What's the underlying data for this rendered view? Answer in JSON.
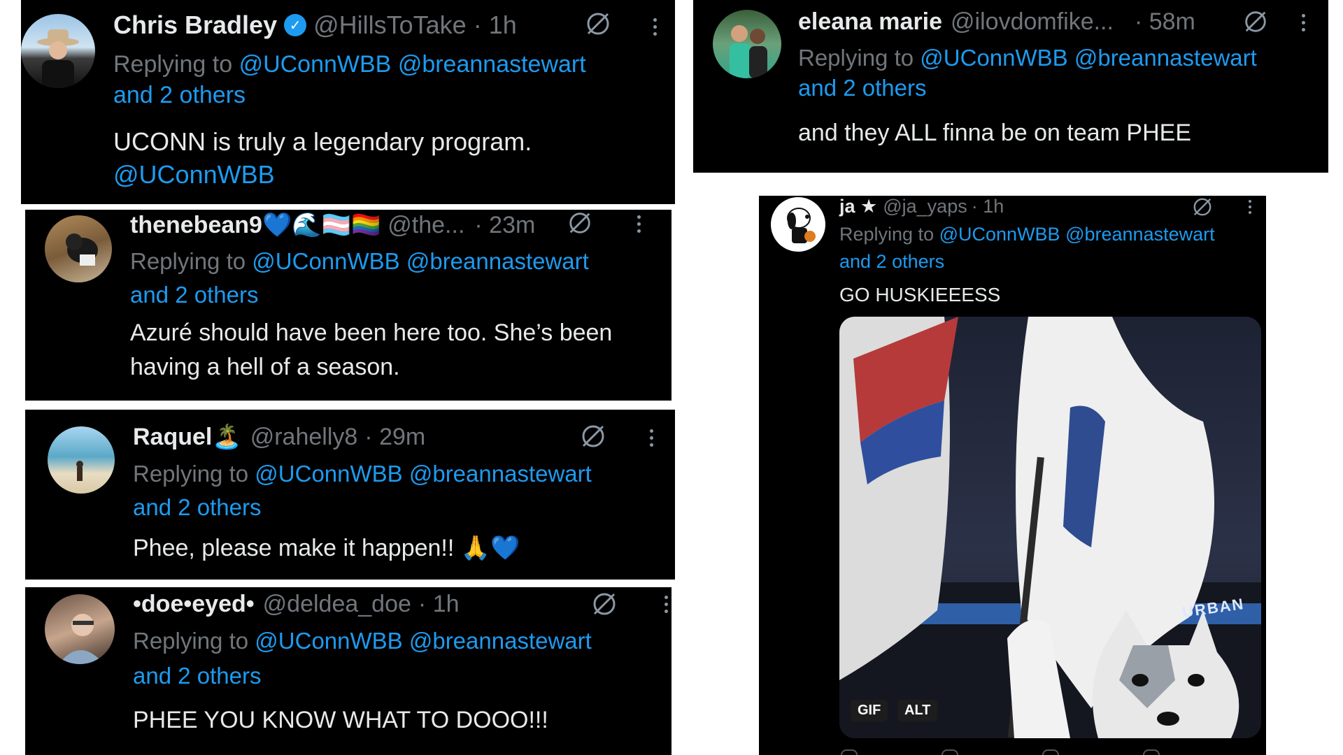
{
  "tweets": [
    {
      "name": "Chris Bradley",
      "handle": "@HillsToTake",
      "time": "· 1h",
      "replying_prefix": "Replying to",
      "mention1": "@UConnWBB",
      "mention2": "@breannastewart",
      "others": "and 2 others",
      "text_line1": "UCONN is truly a legendary program.",
      "text_line2": "@UConnWBB",
      "verified": true
    },
    {
      "name": "eleana marie",
      "handle": "@ilovdomfike...",
      "time": "· 58m",
      "replying_prefix": "Replying to",
      "mention1": "@UConnWBB",
      "mention2": "@breannastewart",
      "others": "and 2 others",
      "text_line1": "and they ALL finna be on team PHEE"
    },
    {
      "name": "thenebean9💙🌊🏳️‍⚧️🏳️‍🌈",
      "handle": "@the...",
      "time": "· 23m",
      "replying_prefix": "Replying to",
      "mention1": "@UConnWBB",
      "mention2": "@breannastewart",
      "others": "and 2 others",
      "text_line1": "Azuré should have been here too. She’s been",
      "text_line2": "having a hell of a season."
    },
    {
      "name": "Raquel🏝️",
      "handle": "@rahelly8",
      "time": "· 29m",
      "replying_prefix": "Replying to",
      "mention1": "@UConnWBB",
      "mention2": "@breannastewart",
      "others": "and 2 others",
      "text_line1": "Phee, please make it happen!! 🙏💙"
    },
    {
      "name": "•doe•eyed•",
      "handle": "@deldea_doe",
      "time": "· 1h",
      "replying_prefix": "Replying to",
      "mention1": "@UConnWBB",
      "mention2": "@breannastewart",
      "others": "and 2 others",
      "text_line1": "PHEE YOU KNOW WHAT TO DOOO!!!"
    },
    {
      "name": "ja ★",
      "handle": "@ja_yaps",
      "time": "· 1h",
      "replying_prefix": "Replying to",
      "mention1": "@UConnWBB",
      "mention2": "@breannastewart",
      "others": "and 2 others",
      "text_line1": "GO HUSKIEEESS",
      "media": {
        "badge_gif": "GIF",
        "badge_alt": "ALT",
        "banner_text": "URBAN"
      }
    }
  ],
  "icons": {
    "grok": "slashed-circle-icon",
    "more": "more-vert-icon",
    "verified": "verified-badge-icon"
  },
  "colors": {
    "background": "#000000",
    "text": "#e7e9ea",
    "muted": "#71767b",
    "link": "#1d9bf0"
  }
}
